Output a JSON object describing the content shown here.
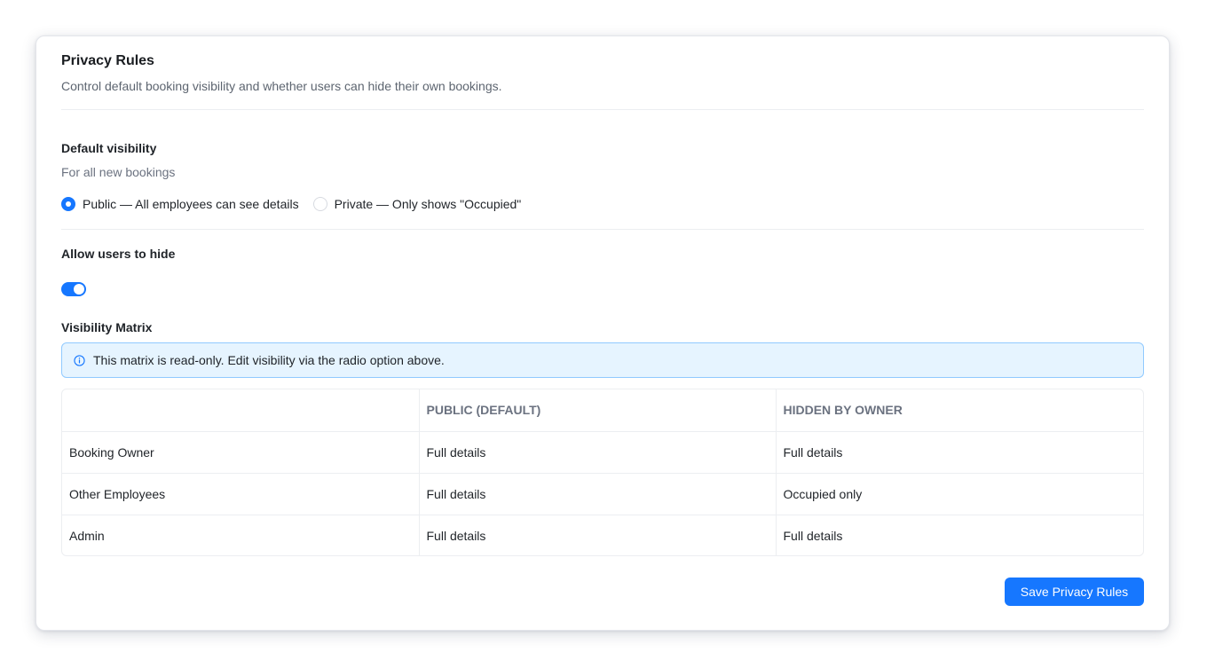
{
  "header": {
    "title": "Privacy Rules",
    "subtitle": "Control default booking visibility and whether users can hide their own bookings."
  },
  "default_visibility": {
    "label": "Default visibility",
    "hint": "For all new bookings",
    "options": [
      {
        "label": "Public — All employees can see details",
        "selected": true
      },
      {
        "label": "Private — Only shows \"Occupied\"",
        "selected": false
      }
    ]
  },
  "allow_hide": {
    "label": "Allow users to hide",
    "enabled": true
  },
  "matrix": {
    "label": "Visibility Matrix",
    "info": "This matrix is read-only. Edit visibility via the radio option above.",
    "columns": [
      "",
      "PUBLIC (DEFAULT)",
      "HIDDEN BY OWNER"
    ],
    "rows": [
      [
        "Booking Owner",
        "Full details",
        "Full details"
      ],
      [
        "Other Employees",
        "Full details",
        "Occupied only"
      ],
      [
        "Admin",
        "Full details",
        "Full details"
      ]
    ]
  },
  "actions": {
    "save_label": "Save Privacy Rules"
  },
  "colors": {
    "accent": "#1677ff",
    "info_bg": "#e6f4ff",
    "info_border": "#91caff"
  },
  "icons": {
    "info": "info-circle-icon"
  }
}
